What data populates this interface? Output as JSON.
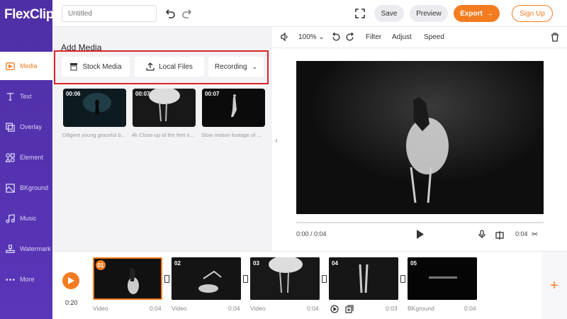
{
  "app": {
    "logo_prefix": "F",
    "logo_rest": "lexClip"
  },
  "topbar": {
    "title_placeholder": "Untitled",
    "save_label": "Save",
    "preview_label": "Preview",
    "export_label": "Export",
    "signup_label": "Sign Up"
  },
  "sidebar": {
    "items": [
      {
        "label": "Media",
        "icon": "media-icon",
        "active": true
      },
      {
        "label": "Text",
        "icon": "text-icon"
      },
      {
        "label": "Overlay",
        "icon": "overlay-icon"
      },
      {
        "label": "Element",
        "icon": "element-icon"
      },
      {
        "label": "BKground",
        "icon": "background-icon"
      },
      {
        "label": "Music",
        "icon": "music-icon"
      },
      {
        "label": "Watermark",
        "icon": "watermark-icon"
      },
      {
        "label": "More",
        "icon": "more-icon"
      }
    ]
  },
  "media_panel": {
    "title": "Add Media",
    "stock_label": "Stock Media",
    "local_label": "Local Files",
    "recording_label": "Recording",
    "thumbs": [
      {
        "duration": "00:06",
        "caption": "Diligent young graceful b..."
      },
      {
        "duration": "00:07",
        "caption": "4k Close-up of the feet o..."
      },
      {
        "duration": "00:07",
        "caption": "Slow motion footage of ..."
      }
    ]
  },
  "preview": {
    "zoom": "100%",
    "filter_label": "Filter",
    "adjust_label": "Adjust",
    "speed_label": "Speed",
    "current_time": "0:00 / 0:04",
    "clip_time": "0:04"
  },
  "timeline": {
    "total_time": "0:20",
    "clips": [
      {
        "num": "01",
        "label": "Video",
        "duration": "0:04"
      },
      {
        "num": "02",
        "label": "Video",
        "duration": "0:04"
      },
      {
        "num": "03",
        "label": "Video",
        "duration": "0:04"
      },
      {
        "num": "04",
        "label": "",
        "duration": "0:03"
      },
      {
        "num": "05",
        "label": "BKground",
        "duration": "0:04"
      }
    ]
  },
  "colors": {
    "accent": "#f47c20",
    "sidebar": "#5a36b8",
    "highlight": "#d8262c"
  }
}
